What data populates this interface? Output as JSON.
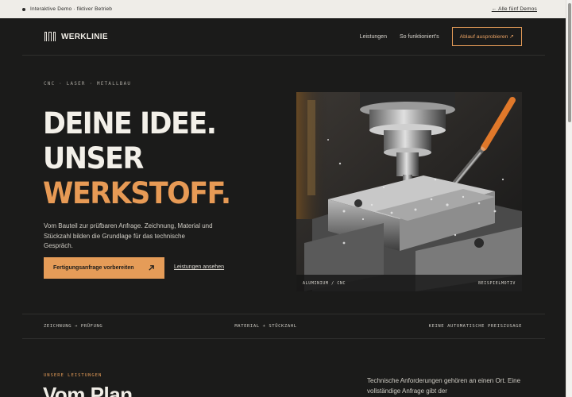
{
  "demo_bar": {
    "notice": "Interaktive Demo · fiktiver Betrieb",
    "back_link": "← Alle fünf Demos"
  },
  "nav": {
    "brand": "WERKLINIE",
    "links": [
      "Leistungen",
      "So funktioniert's"
    ],
    "cta": "Ablauf ausprobieren ↗"
  },
  "hero": {
    "eyebrow": "CNC · LASER · METALLBAU",
    "headline_line1": "DEINE IDEE.",
    "headline_line2": "UNSER",
    "headline_line3": "WERKSTOFF.",
    "lead": "Vom Bauteil zur prüfbaren Anfrage. Zeichnung, Material und Stückzahl bilden die Grundlage für das technische Gespräch.",
    "primary_button": "Fertigungsanfrage vorbereiten",
    "primary_icon": "arrow-up-right-icon",
    "secondary_link": "Leistungen ansehen",
    "image_caption_left": "ALUMINIUM / CNC",
    "image_caption_right": "BEISPIELMOTIV"
  },
  "strip": {
    "left": "ZEICHNUNG → PRÜFUNG",
    "center": "MATERIAL + STÜCKZAHL",
    "right": "KEINE AUTOMATISCHE PREISZUSAGE"
  },
  "services": {
    "eyebrow": "UNSERE LEISTUNGEN",
    "title": "Vom Plan",
    "text": "Technische Anforderungen gehören an einen Ort. Eine vollständige Anfrage gibt der"
  },
  "colors": {
    "background": "#1b1b1a",
    "accent": "#e59c58",
    "text": "#e9e6df"
  }
}
